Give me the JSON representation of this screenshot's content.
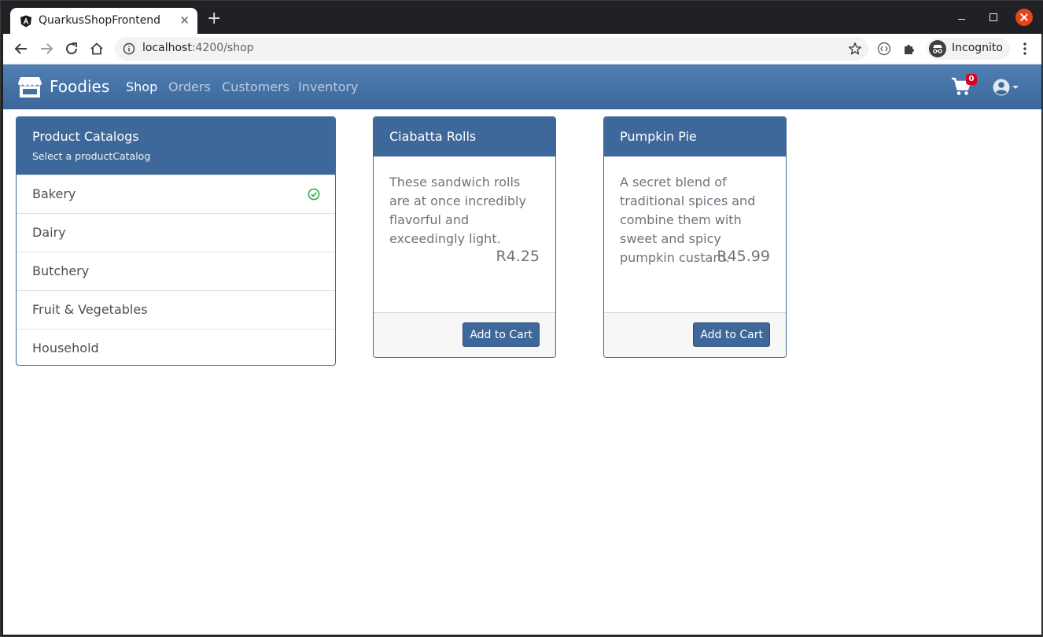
{
  "browser": {
    "tab_title": "QuarkusShopFrontend",
    "tab_close": "✕",
    "new_tab": "+",
    "url_host": "localhost",
    "url_path": ":4200/shop",
    "incognito_label": "Incognito"
  },
  "navbar": {
    "brand": "Foodies",
    "links": [
      "Shop",
      "Orders",
      "Customers",
      "Inventory"
    ],
    "active_link": "Shop",
    "cart_count": "0"
  },
  "catalog": {
    "title": "Product Catalogs",
    "subtitle": "Select a productCatalog",
    "items": [
      {
        "label": "Bakery",
        "selected": true
      },
      {
        "label": "Dairy",
        "selected": false
      },
      {
        "label": "Butchery",
        "selected": false
      },
      {
        "label": "Fruit & Vegetables",
        "selected": false
      },
      {
        "label": "Household",
        "selected": false
      }
    ]
  },
  "products": [
    {
      "name": "Ciabatta Rolls",
      "description": "These sandwich rolls are at once incredibly flavorful and exceedingly light.",
      "price": "R4.25",
      "button": "Add to Cart"
    },
    {
      "name": "Pumpkin Pie",
      "description": "A secret blend of traditional spices and combine them with sweet and spicy pumpkin custard.",
      "price": "R45.99",
      "button": "Add to Cart"
    }
  ],
  "colors": {
    "navbar": "#3e6899",
    "accent": "#3e6899",
    "check": "#28a745",
    "badge": "#d9001b"
  }
}
